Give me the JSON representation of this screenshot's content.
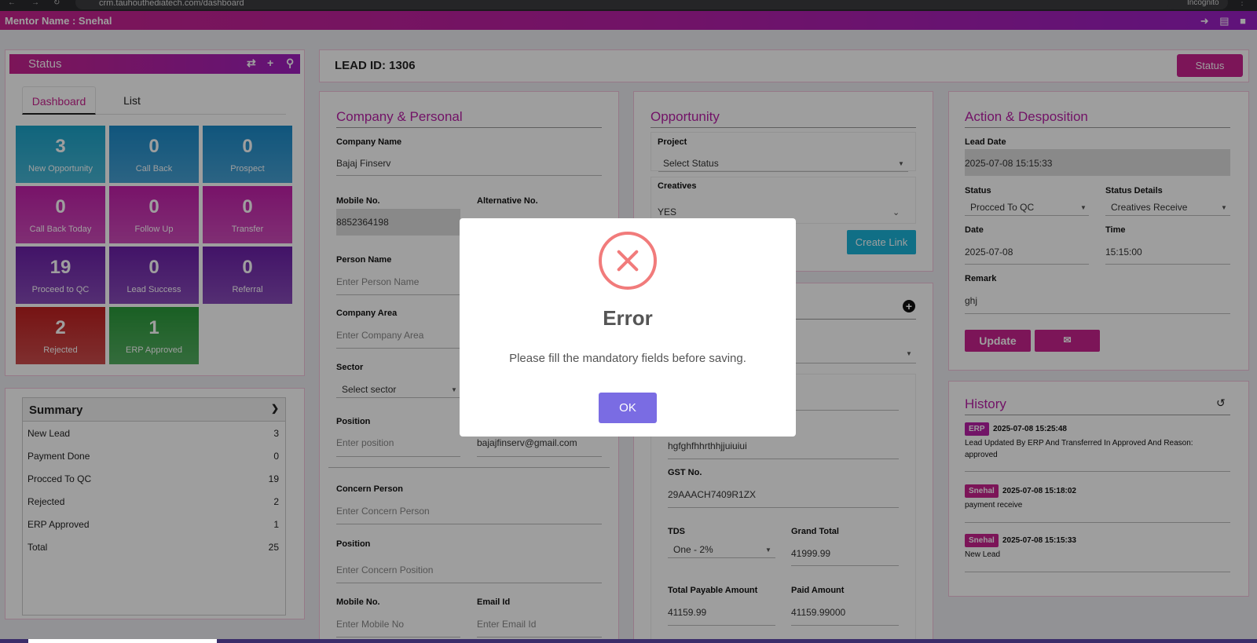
{
  "browser": {
    "url": "crm.tauhouthediatech.com/dashboard",
    "mode": "Incognito"
  },
  "topbar": {
    "mentor": "Mentor Name : Snehal",
    "icons": [
      "logout-icon",
      "list-icon",
      "lock-icon"
    ]
  },
  "status_panel": {
    "title": "Status",
    "tabs": [
      {
        "label": "Dashboard"
      },
      {
        "label": "List"
      }
    ],
    "tiles": [
      {
        "count": "3",
        "label": "New Opportunity",
        "color": "#1aa3c9"
      },
      {
        "count": "0",
        "label": "Call Back",
        "color": "#1a8ac9"
      },
      {
        "count": "0",
        "label": "Prospect",
        "color": "#1a8ac9"
      },
      {
        "count": "0",
        "label": "Call Back Today",
        "color": "#c21faa"
      },
      {
        "count": "0",
        "label": "Follow Up",
        "color": "#c21faa"
      },
      {
        "count": "0",
        "label": "Transfer",
        "color": "#c21faa"
      },
      {
        "count": "19",
        "label": "Proceed to QC",
        "color": "#6b1fa8"
      },
      {
        "count": "0",
        "label": "Lead Success",
        "color": "#6b1fa8"
      },
      {
        "count": "0",
        "label": "Referral",
        "color": "#6b1fa8"
      },
      {
        "count": "2",
        "label": "Rejected",
        "color": "#c02020"
      },
      {
        "count": "1",
        "label": "ERP Approved",
        "color": "#2a9a3a"
      }
    ]
  },
  "summary": {
    "title": "Summary",
    "rows": [
      {
        "label": "New Lead",
        "value": "3"
      },
      {
        "label": "Payment Done",
        "value": "0"
      },
      {
        "label": "Procced To QC",
        "value": "19"
      },
      {
        "label": "Rejected",
        "value": "2"
      },
      {
        "label": "ERP Approved",
        "value": "1"
      },
      {
        "label": "Total",
        "value": "25"
      }
    ]
  },
  "lead": {
    "id_label": "LEAD ID: 1306",
    "status_button": "Status"
  },
  "company": {
    "title": "Company & Personal",
    "company_name_label": "Company Name",
    "company_name": "Bajaj Finserv",
    "mobile_label": "Mobile No.",
    "mobile": "8852364198",
    "alt_label": "Alternative No.",
    "person_label": "Person Name",
    "person_ph": "Enter Person Name",
    "area_label": "Company Area",
    "area_ph": "Enter Company Area",
    "sector_label": "Sector",
    "sector_value": "Select sector",
    "position_label": "Position",
    "position_ph": "Enter position",
    "email": "bajajfinserv@gmail.com",
    "concern_label": "Concern Person",
    "concern_ph": "Enter Concern Person",
    "concern_pos_label": "Position",
    "concern_pos_ph": "Enter Concern Position",
    "c_mobile_label": "Mobile No.",
    "c_mobile_ph": "Enter Mobile No",
    "c_email_label": "Email Id",
    "c_email_ph": "Enter Email Id"
  },
  "opportunity": {
    "title": "Opportunity",
    "project_label": "Project",
    "project_value": "Select Status",
    "creatives_label": "Creatives",
    "creatives_value": "YES",
    "create_link": "Create Link",
    "address_value": "hgfghfhhrthhjjuiuiui",
    "gst_label": "GST No.",
    "gst_value": "29AAACH7409R1ZX",
    "tds_label": "TDS",
    "tds_value": "One - 2%",
    "grand_total_label": "Grand Total",
    "grand_total": "41999.99",
    "total_payable_label": "Total Payable Amount",
    "total_payable": "41159.99",
    "paid_label": "Paid Amount",
    "paid": "41159.99000"
  },
  "action": {
    "title": "Action & Desposition",
    "lead_date_label": "Lead Date",
    "lead_date": "2025-07-08 15:15:33",
    "status_label": "Status",
    "status_value": "Procced To QC",
    "status_details_label": "Status Details",
    "status_details_value": "Creatives Receive",
    "date_label": "Date",
    "date_value": "2025-07-08",
    "time_label": "Time",
    "time_value": "15:15:00",
    "remark_label": "Remark",
    "remark_value": "ghj",
    "update_button": "Update"
  },
  "history": {
    "title": "History",
    "entries": [
      {
        "badge": "ERP",
        "time": "2025-07-08 15:25:48",
        "text": "Lead Updated By ERP And Transferred In Approved And Reason:",
        "text2": "approved"
      },
      {
        "badge": "Snehal",
        "time": "2025-07-08 15:18:02",
        "text": "payment receive"
      },
      {
        "badge": "Snehal",
        "time": "2025-07-08 15:15:33",
        "text": "New Lead"
      }
    ]
  },
  "modal": {
    "title": "Error",
    "message": "Please fill the mandatory fields before saving.",
    "ok": "OK"
  }
}
